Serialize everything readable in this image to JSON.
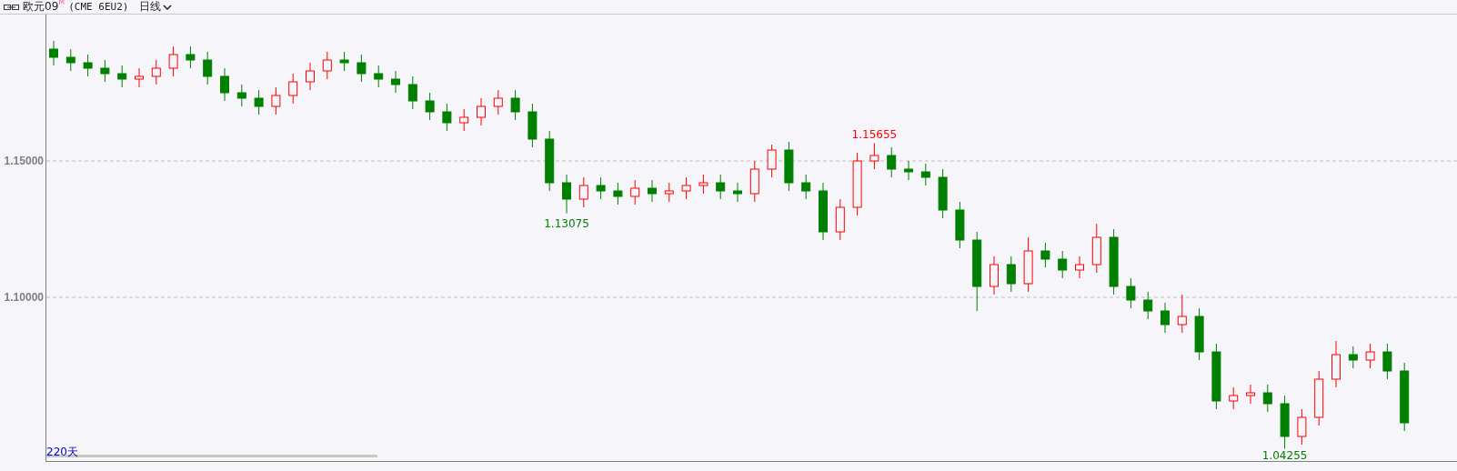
{
  "header": {
    "symbol": "欧元09",
    "badge": "M",
    "contract": "(CME 6EU2)",
    "period": "日线"
  },
  "chart": {
    "axis_labels": [
      "1.15000",
      "1.10000"
    ],
    "price_marks": [
      {
        "text": "1.15655",
        "kind": "high"
      },
      {
        "text": "1.13075",
        "kind": "low"
      },
      {
        "text": "1.04255",
        "kind": "low"
      }
    ],
    "footer_label": "220天"
  }
}
